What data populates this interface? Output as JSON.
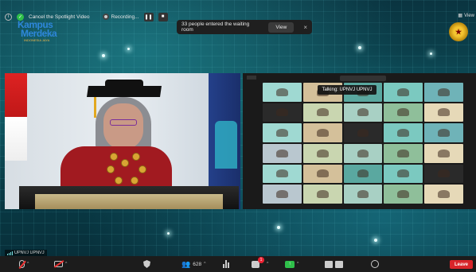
{
  "topbar": {
    "spotlight_label": "Cancel the Spotlight Video",
    "recording_label": "Recording...",
    "pause_glyph": "❚❚",
    "stop_glyph": "■"
  },
  "branding": {
    "logo_line1": "Kampus",
    "logo_line2": "Merdeka",
    "logo_tagline": "INDONESIA JAYA"
  },
  "view_toggle": {
    "label": "View"
  },
  "notice": {
    "text": "33 people entered the waiting room",
    "view_button": "View",
    "close_glyph": "×"
  },
  "gallery": {
    "talking_label": "Talking: UPNVJ UPNVJ"
  },
  "active_speaker": {
    "name": "UPNVJ UPNVJ"
  },
  "toolbar": {
    "participants_count": "628",
    "chat_badge": "1",
    "leave_label": "Leave"
  },
  "icons": {
    "info": "info-icon",
    "shield": "shield-icon",
    "record": "record-icon",
    "mic": "mic-muted-icon",
    "video": "video-off-icon",
    "security": "security-icon",
    "participants": "participants-icon",
    "polls": "polls-icon",
    "chat": "chat-icon",
    "share": "share-screen-icon",
    "recording": "record-icon",
    "reactions": "reactions-icon"
  },
  "colors": {
    "accent_green": "#2fbf4a",
    "leave_red": "#d9252a",
    "toolbar_bg": "#1c1c1c"
  }
}
